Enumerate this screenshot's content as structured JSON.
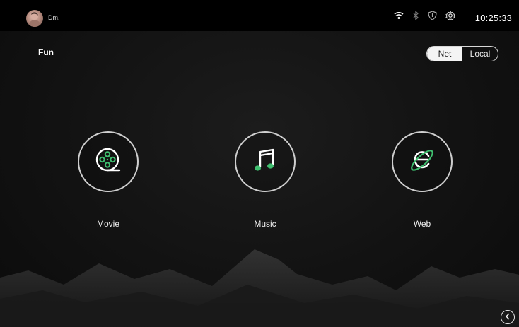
{
  "statusbar": {
    "username": "Dm.",
    "time": "10:25:33",
    "icons": [
      "wifi-icon",
      "bluetooth-icon",
      "shield-icon",
      "settings-icon"
    ]
  },
  "page": {
    "title": "Fun"
  },
  "source_toggle": {
    "options": [
      "Net",
      "Local"
    ],
    "selected": "Net"
  },
  "apps": [
    {
      "label": "Movie",
      "icon": "film-reel-icon"
    },
    {
      "label": "Music",
      "icon": "music-note-icon"
    },
    {
      "label": "Web",
      "icon": "browser-globe-icon"
    }
  ],
  "navigation": {
    "back_icon": "chevron-left-icon"
  },
  "colors": {
    "accent_green": "#3fbf6f",
    "background": "#121212",
    "statusbar": "#000000"
  }
}
